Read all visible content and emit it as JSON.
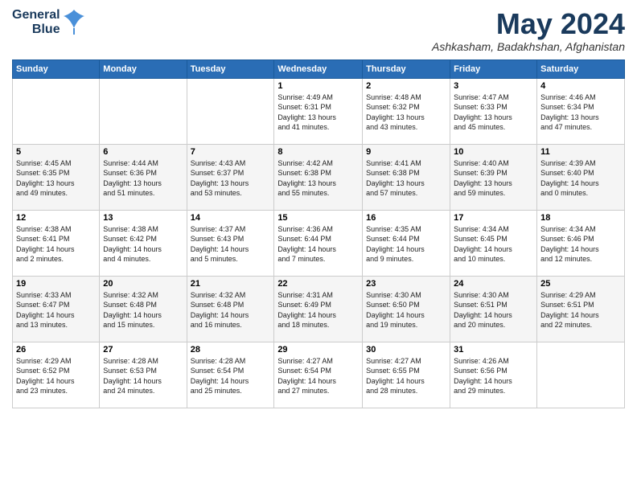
{
  "header": {
    "logo_line1": "General",
    "logo_line2": "Blue",
    "month": "May 2024",
    "location": "Ashkasham, Badakhshan, Afghanistan"
  },
  "days_of_week": [
    "Sunday",
    "Monday",
    "Tuesday",
    "Wednesday",
    "Thursday",
    "Friday",
    "Saturday"
  ],
  "weeks": [
    [
      {
        "day": "",
        "info": ""
      },
      {
        "day": "",
        "info": ""
      },
      {
        "day": "",
        "info": ""
      },
      {
        "day": "1",
        "info": "Sunrise: 4:49 AM\nSunset: 6:31 PM\nDaylight: 13 hours\nand 41 minutes."
      },
      {
        "day": "2",
        "info": "Sunrise: 4:48 AM\nSunset: 6:32 PM\nDaylight: 13 hours\nand 43 minutes."
      },
      {
        "day": "3",
        "info": "Sunrise: 4:47 AM\nSunset: 6:33 PM\nDaylight: 13 hours\nand 45 minutes."
      },
      {
        "day": "4",
        "info": "Sunrise: 4:46 AM\nSunset: 6:34 PM\nDaylight: 13 hours\nand 47 minutes."
      }
    ],
    [
      {
        "day": "5",
        "info": "Sunrise: 4:45 AM\nSunset: 6:35 PM\nDaylight: 13 hours\nand 49 minutes."
      },
      {
        "day": "6",
        "info": "Sunrise: 4:44 AM\nSunset: 6:36 PM\nDaylight: 13 hours\nand 51 minutes."
      },
      {
        "day": "7",
        "info": "Sunrise: 4:43 AM\nSunset: 6:37 PM\nDaylight: 13 hours\nand 53 minutes."
      },
      {
        "day": "8",
        "info": "Sunrise: 4:42 AM\nSunset: 6:38 PM\nDaylight: 13 hours\nand 55 minutes."
      },
      {
        "day": "9",
        "info": "Sunrise: 4:41 AM\nSunset: 6:38 PM\nDaylight: 13 hours\nand 57 minutes."
      },
      {
        "day": "10",
        "info": "Sunrise: 4:40 AM\nSunset: 6:39 PM\nDaylight: 13 hours\nand 59 minutes."
      },
      {
        "day": "11",
        "info": "Sunrise: 4:39 AM\nSunset: 6:40 PM\nDaylight: 14 hours\nand 0 minutes."
      }
    ],
    [
      {
        "day": "12",
        "info": "Sunrise: 4:38 AM\nSunset: 6:41 PM\nDaylight: 14 hours\nand 2 minutes."
      },
      {
        "day": "13",
        "info": "Sunrise: 4:38 AM\nSunset: 6:42 PM\nDaylight: 14 hours\nand 4 minutes."
      },
      {
        "day": "14",
        "info": "Sunrise: 4:37 AM\nSunset: 6:43 PM\nDaylight: 14 hours\nand 5 minutes."
      },
      {
        "day": "15",
        "info": "Sunrise: 4:36 AM\nSunset: 6:44 PM\nDaylight: 14 hours\nand 7 minutes."
      },
      {
        "day": "16",
        "info": "Sunrise: 4:35 AM\nSunset: 6:44 PM\nDaylight: 14 hours\nand 9 minutes."
      },
      {
        "day": "17",
        "info": "Sunrise: 4:34 AM\nSunset: 6:45 PM\nDaylight: 14 hours\nand 10 minutes."
      },
      {
        "day": "18",
        "info": "Sunrise: 4:34 AM\nSunset: 6:46 PM\nDaylight: 14 hours\nand 12 minutes."
      }
    ],
    [
      {
        "day": "19",
        "info": "Sunrise: 4:33 AM\nSunset: 6:47 PM\nDaylight: 14 hours\nand 13 minutes."
      },
      {
        "day": "20",
        "info": "Sunrise: 4:32 AM\nSunset: 6:48 PM\nDaylight: 14 hours\nand 15 minutes."
      },
      {
        "day": "21",
        "info": "Sunrise: 4:32 AM\nSunset: 6:48 PM\nDaylight: 14 hours\nand 16 minutes."
      },
      {
        "day": "22",
        "info": "Sunrise: 4:31 AM\nSunset: 6:49 PM\nDaylight: 14 hours\nand 18 minutes."
      },
      {
        "day": "23",
        "info": "Sunrise: 4:30 AM\nSunset: 6:50 PM\nDaylight: 14 hours\nand 19 minutes."
      },
      {
        "day": "24",
        "info": "Sunrise: 4:30 AM\nSunset: 6:51 PM\nDaylight: 14 hours\nand 20 minutes."
      },
      {
        "day": "25",
        "info": "Sunrise: 4:29 AM\nSunset: 6:51 PM\nDaylight: 14 hours\nand 22 minutes."
      }
    ],
    [
      {
        "day": "26",
        "info": "Sunrise: 4:29 AM\nSunset: 6:52 PM\nDaylight: 14 hours\nand 23 minutes."
      },
      {
        "day": "27",
        "info": "Sunrise: 4:28 AM\nSunset: 6:53 PM\nDaylight: 14 hours\nand 24 minutes."
      },
      {
        "day": "28",
        "info": "Sunrise: 4:28 AM\nSunset: 6:54 PM\nDaylight: 14 hours\nand 25 minutes."
      },
      {
        "day": "29",
        "info": "Sunrise: 4:27 AM\nSunset: 6:54 PM\nDaylight: 14 hours\nand 27 minutes."
      },
      {
        "day": "30",
        "info": "Sunrise: 4:27 AM\nSunset: 6:55 PM\nDaylight: 14 hours\nand 28 minutes."
      },
      {
        "day": "31",
        "info": "Sunrise: 4:26 AM\nSunset: 6:56 PM\nDaylight: 14 hours\nand 29 minutes."
      },
      {
        "day": "",
        "info": ""
      }
    ]
  ]
}
